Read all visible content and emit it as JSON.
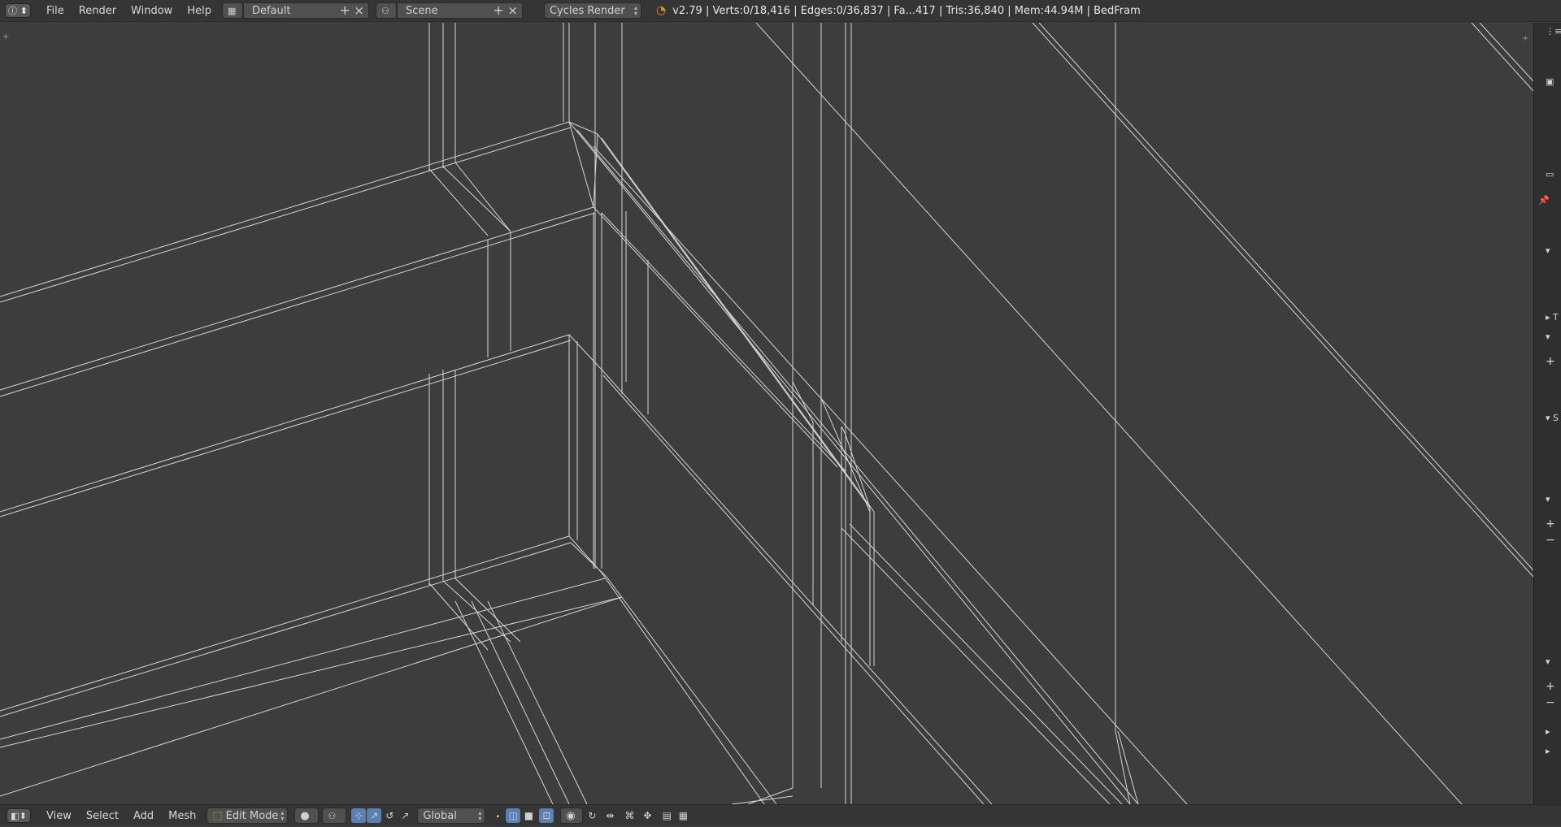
{
  "top_bar": {
    "menus": [
      "File",
      "Render",
      "Window",
      "Help"
    ],
    "screen_layout": "Default",
    "scene": "Scene",
    "render_engine": "Cycles Render",
    "stats": "v2.79 | Verts:0/18,416 | Edges:0/36,837 | Fa...417 | Tris:36,840 | Mem:44.94M | BedFram"
  },
  "bottom_bar": {
    "menus": [
      "View",
      "Select",
      "Add",
      "Mesh"
    ],
    "mode": "Edit Mode",
    "orientation": "Global"
  },
  "right_panel": {
    "labels": {
      "t_panel": "T",
      "s_panel": "S"
    }
  },
  "icons": [
    "info-icon",
    "screen-layout-icon",
    "scene-icon",
    "blender-logo-icon",
    "editor-type-icon",
    "edit-mode-icon",
    "viewport-shading-icon",
    "pivot-icon",
    "manipulator-icons",
    "select-mode-icons",
    "proportional-edit-icon",
    "snap-icon",
    "render-icon"
  ],
  "colors": {
    "viewport_bg": "#3d3d3d",
    "header_bg": "#353535",
    "wire": "#e4e4e4",
    "tool_active": "#5b7fb0"
  }
}
